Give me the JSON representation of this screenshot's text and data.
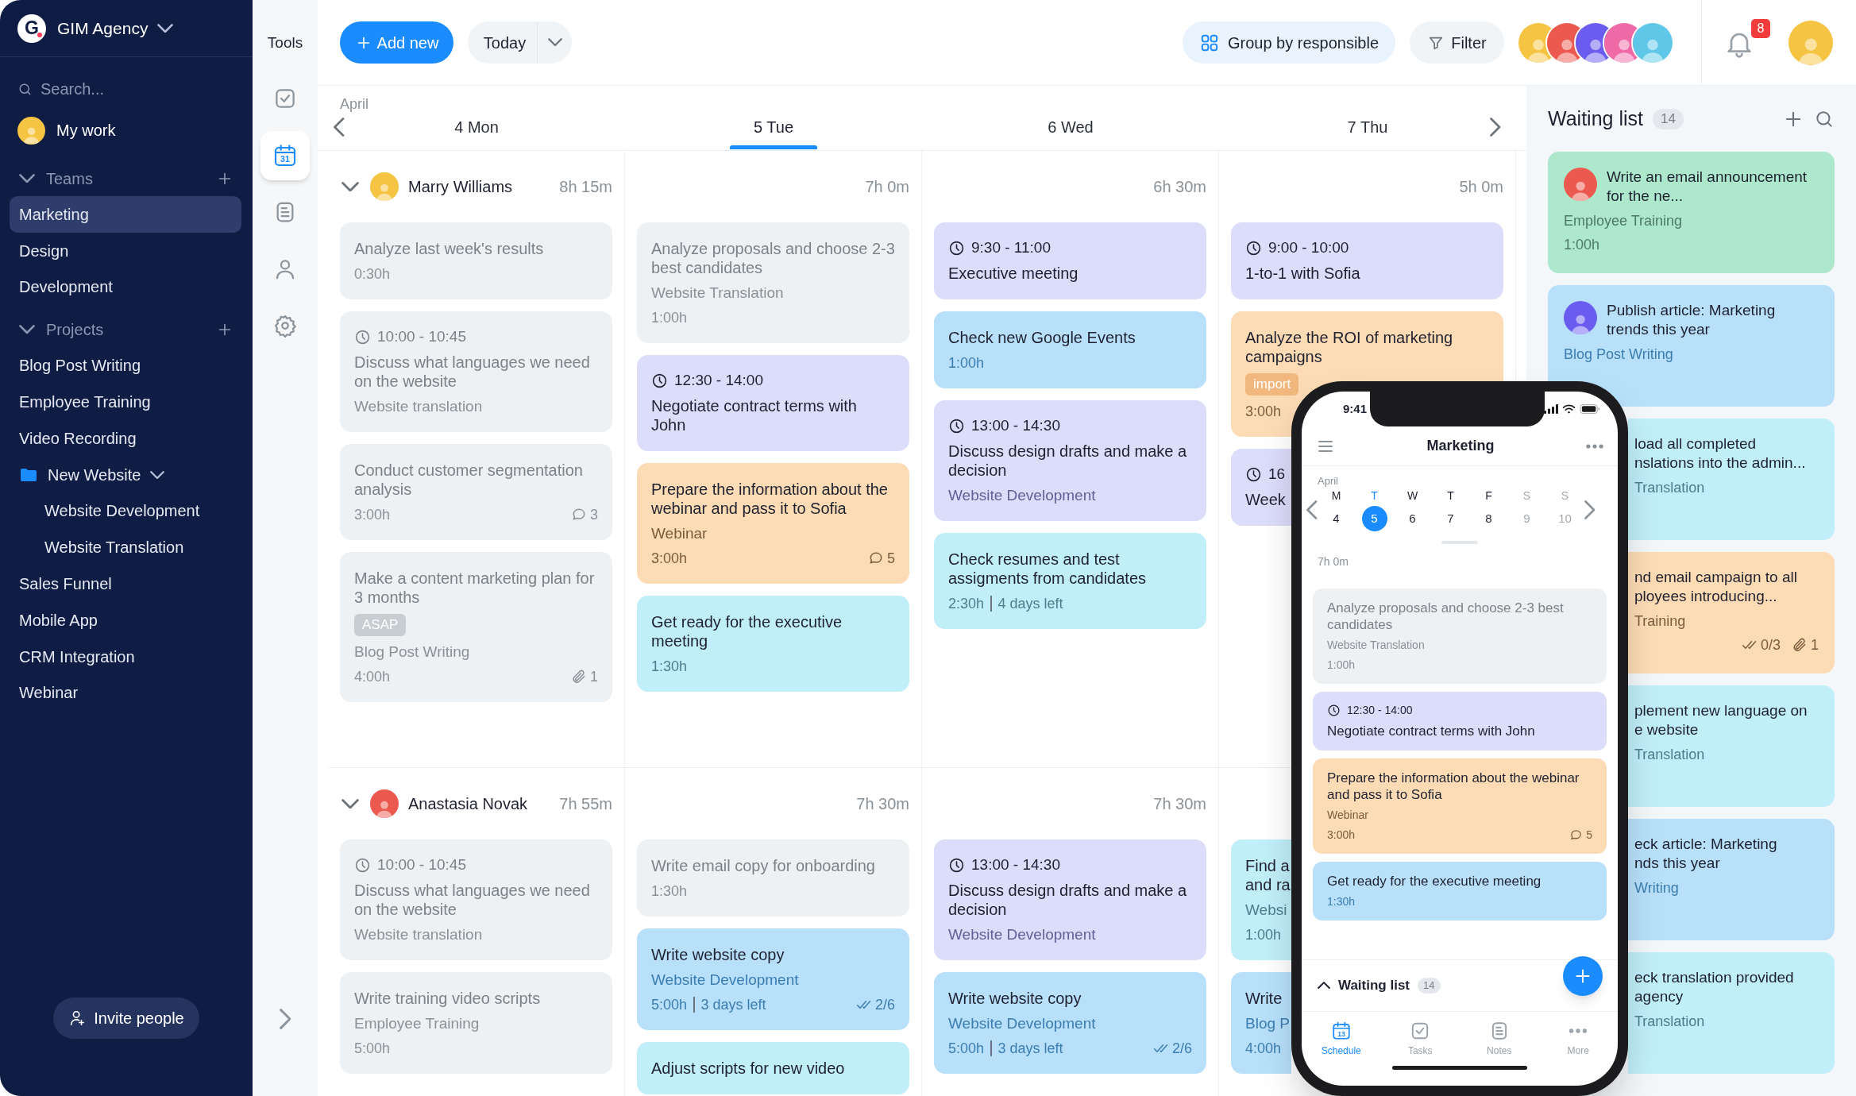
{
  "sidebar": {
    "logo": "G",
    "workspace": "GIM Agency",
    "search": {
      "placeholder": "Search..."
    },
    "my_work": {
      "label": "My work",
      "avatar": {
        "color": "#f6c443"
      }
    },
    "sections": [
      {
        "title": "Teams",
        "expanded": true,
        "items": [
          {
            "label": "Marketing",
            "selected": true
          },
          {
            "label": "Design",
            "selected": false
          },
          {
            "label": "Development",
            "selected": false
          }
        ]
      },
      {
        "title": "Projects",
        "expanded": true,
        "items": [
          {
            "label": "Blog Post Writing",
            "selected": false
          },
          {
            "label": "Employee Training",
            "selected": false
          },
          {
            "label": "Video Recording",
            "selected": false
          },
          {
            "label": "New Website",
            "kind": "folder",
            "selected": false,
            "expanded": true,
            "children": [
              {
                "label": "Website Development",
                "selected": false
              },
              {
                "label": "Website Translation",
                "selected": false
              }
            ]
          },
          {
            "label": "Sales Funnel",
            "selected": false
          },
          {
            "label": "Mobile App",
            "selected": false
          },
          {
            "label": "CRM Integration",
            "selected": false
          },
          {
            "label": "Webinar",
            "selected": false
          }
        ]
      }
    ],
    "invite_button": "Invite people"
  },
  "tools": {
    "title": "Tools",
    "items": [
      {
        "kind": "tasks",
        "selected": false
      },
      {
        "kind": "calendar",
        "selected": true,
        "day": "31"
      },
      {
        "kind": "notes",
        "selected": false
      },
      {
        "kind": "people",
        "selected": false
      },
      {
        "kind": "settings",
        "selected": false
      }
    ]
  },
  "toolbar": {
    "add_button": "Add new",
    "today_button": "Today",
    "group_button": "Group by responsible",
    "filter_button": "Filter",
    "members": [
      {
        "color": "#f6c443"
      },
      {
        "color": "#ec5a4f"
      },
      {
        "color": "#6b5cf0"
      },
      {
        "color": "#f06aa8"
      },
      {
        "color": "#5fc8e8"
      }
    ],
    "notifications": "8",
    "user": {
      "color": "#f6c443"
    }
  },
  "calendar": {
    "month": "April",
    "days": [
      {
        "label": "4 Mon",
        "selected": false
      },
      {
        "label": "5 Tue",
        "selected": true
      },
      {
        "label": "6 Wed",
        "selected": false
      },
      {
        "label": "7 Thu",
        "selected": false
      }
    ],
    "people": [
      {
        "name": "Marry Williams",
        "avatar": {
          "color": "#f6c443"
        },
        "total": "8h 15m",
        "expanded": true,
        "days": [
          {
            "cards": [
              {
                "kind": "full",
                "color": "#eef1f3",
                "title": "Analyze last week's results",
                "duration": "0:30h"
              },
              {
                "kind": "full",
                "color": "#eef1f3",
                "time": "10:00 - 10:45",
                "title": "Discuss what languages we need on the website",
                "project": "Website translation"
              },
              {
                "kind": "full",
                "color": "#eef1f3",
                "title": "Conduct customer segmentation analysis",
                "duration": "3:00h",
                "comments": "3"
              },
              {
                "kind": "full",
                "color": "#eef1f3",
                "title": "Make a content marketing plan for 3 months",
                "tag": "ASAP",
                "project": "Blog Post Writing",
                "duration": "4:00h",
                "attachments": "1"
              }
            ]
          },
          {
            "total": "7h 0m",
            "cards": [
              {
                "kind": "full",
                "color": "#eef1f3",
                "title": "Analyze proposals and choose 2-3 best candidates",
                "project": "Website Translation",
                "duration": "1:00h"
              },
              {
                "kind": "full",
                "color": "#dcdcfb",
                "time": "12:30 - 14:00",
                "title": "Negotiate contract terms with John"
              },
              {
                "kind": "full",
                "color": "#fddbb5",
                "title": "Prepare the information about the webinar and pass it to Sofia",
                "project": "Webinar",
                "duration": "3:00h",
                "comments": "5"
              },
              {
                "kind": "full",
                "color": "#c0eef9",
                "title": "Get ready for the executive meeting",
                "duration": "1:30h"
              }
            ]
          },
          {
            "total": "6h 30m",
            "cards": [
              {
                "kind": "full",
                "color": "#dcdcfb",
                "time": "9:30 - 11:00",
                "title": "Executive meeting"
              },
              {
                "kind": "full",
                "color": "#b8e0fb",
                "title": "Check new Google Events",
                "duration": "1:00h"
              },
              {
                "kind": "full",
                "color": "#dcdcfb",
                "time": "13:00 - 14:30",
                "title": "Discuss design drafts and make a decision",
                "project": "Website Development"
              },
              {
                "kind": "full",
                "color": "#c0eef9",
                "title": "Check resumes and test assigments from candidates",
                "duration": "2:30h",
                "due": "4 days left"
              }
            ]
          },
          {
            "total": "5h 0m",
            "cards": [
              {
                "kind": "full",
                "color": "#dcdcfb",
                "time": "9:00 - 10:00",
                "title": "1-to-1 with Sofia"
              },
              {
                "kind": "full",
                "color": "#fddbb5",
                "title": "Analyze the ROI of marketing campaigns",
                "tag": "import",
                "duration": "3:00h"
              },
              {
                "kind": "covered",
                "color": "#dcdcfb",
                "time": "16",
                "title": "Week"
              }
            ]
          }
        ]
      },
      {
        "name": "Anastasia Novak",
        "avatar": {
          "color": "#ec5a4f"
        },
        "total": "7h 55m",
        "expanded": true,
        "days": [
          {
            "cards": [
              {
                "kind": "full",
                "color": "#eef1f3",
                "time": "10:00 - 10:45",
                "title": "Discuss what languages we need on the website",
                "project": "Website translation"
              },
              {
                "kind": "full",
                "color": "#eef1f3",
                "title": "Write training video scripts",
                "project": "Employee Training",
                "duration": "5:00h"
              }
            ]
          },
          {
            "total": "7h 30m",
            "cards": [
              {
                "kind": "full",
                "color": "#eef1f3",
                "title": "Write email copy for onboarding",
                "duration": "1:30h"
              },
              {
                "kind": "full",
                "color": "#b8e0fb",
                "title": "Write website copy",
                "project": "Website Development",
                "duration": "5:00h",
                "due": "3 days left",
                "subtasks": "2/6"
              },
              {
                "kind": "full",
                "color": "#c0eef9",
                "title": "Adjust scripts for new video"
              }
            ]
          },
          {
            "total": "7h 30m",
            "cards": [
              {
                "kind": "full",
                "color": "#dcdcfb",
                "time": "13:00 - 14:30",
                "title": "Discuss design drafts and make a decision",
                "project": "Website Development"
              },
              {
                "kind": "full",
                "color": "#b8e0fb",
                "title": "Write website copy",
                "project": "Website Development",
                "duration": "5:00h",
                "due": "3 days left",
                "subtasks": "2/6"
              }
            ]
          },
          {
            "cards": [
              {
                "kind": "covered",
                "color": "#c0eef9",
                "title": "Find a\nand ra",
                "project": "Websi",
                "duration": "1:00h"
              },
              {
                "kind": "covered",
                "color": "#b8e0fb",
                "title": "Write",
                "project": "Blog P",
                "duration": "4:00h"
              }
            ]
          }
        ]
      }
    ]
  },
  "waiting_list": {
    "title": "Waiting list",
    "count": "14",
    "cards": [
      {
        "kind": "full",
        "color": "#ade8cd",
        "avatar": {
          "color": "#ec5a4f"
        },
        "title": "Write an email announcement for the ne...",
        "project": "Employee Training",
        "duration": "1:00h"
      },
      {
        "kind": "full",
        "color": "#b8e0fb",
        "avatar": {
          "color": "#6b5cf0"
        },
        "title": "Publish article: Marketing trends this year",
        "project": "Blog Post Writing"
      },
      {
        "kind": "covered",
        "color": "#c0eef9",
        "title": "load all completed\nnslations into the admin...",
        "project": "Translation"
      },
      {
        "kind": "covered",
        "color": "#fddbb5",
        "title": "nd email campaign to all\nployees introducing...",
        "project": "Training",
        "subtasks": "0/3",
        "attachments": "1"
      },
      {
        "kind": "covered",
        "color": "#c0eef9",
        "title": "plement new language on\ne website",
        "project": "Translation"
      },
      {
        "kind": "covered",
        "color": "#b8e0fb",
        "title": "eck article: Marketing\nnds this year",
        "project": "Writing"
      },
      {
        "kind": "covered",
        "color": "#c0eef9",
        "title": "eck translation provided\nagency",
        "project": "Translation"
      }
    ]
  },
  "phone": {
    "time": "9:41",
    "title": "Marketing",
    "month": "April",
    "week": [
      {
        "letter": "M",
        "day": "4",
        "selected": false,
        "weekend": false
      },
      {
        "letter": "T",
        "day": "5",
        "selected": true,
        "weekend": false
      },
      {
        "letter": "W",
        "day": "6",
        "selected": false,
        "weekend": false
      },
      {
        "letter": "T",
        "day": "7",
        "selected": false,
        "weekend": false
      },
      {
        "letter": "F",
        "day": "8",
        "selected": false,
        "weekend": false
      },
      {
        "letter": "S",
        "day": "9",
        "selected": false,
        "weekend": true
      },
      {
        "letter": "S",
        "day": "10",
        "selected": false,
        "weekend": true
      }
    ],
    "total": "7h 0m",
    "cards": [
      {
        "color": "#eef1f3",
        "title": "Analyze proposals and choose 2-3 best candidates",
        "project": "Website Translation",
        "duration": "1:00h"
      },
      {
        "color": "#dcdcfb",
        "time": "12:30 - 14:00",
        "title": "Negotiate contract terms with John"
      },
      {
        "color": "#fddbb5",
        "title": "Prepare the information about the webinar and pass it to Sofia",
        "project": "Webinar",
        "duration": "3:00h",
        "comments": "5"
      },
      {
        "color": "#b8e0fb",
        "title": "Get ready for the executive meeting",
        "duration": "1:30h"
      }
    ],
    "waiting": {
      "label": "Waiting list",
      "count": "14",
      "expanded": false
    },
    "tabs": [
      {
        "kind": "schedule",
        "label": "Schedule",
        "selected": true,
        "day": "13"
      },
      {
        "kind": "tasks",
        "label": "Tasks",
        "selected": false
      },
      {
        "kind": "notes",
        "label": "Notes",
        "selected": false
      },
      {
        "kind": "more",
        "label": "More",
        "selected": false
      }
    ]
  }
}
